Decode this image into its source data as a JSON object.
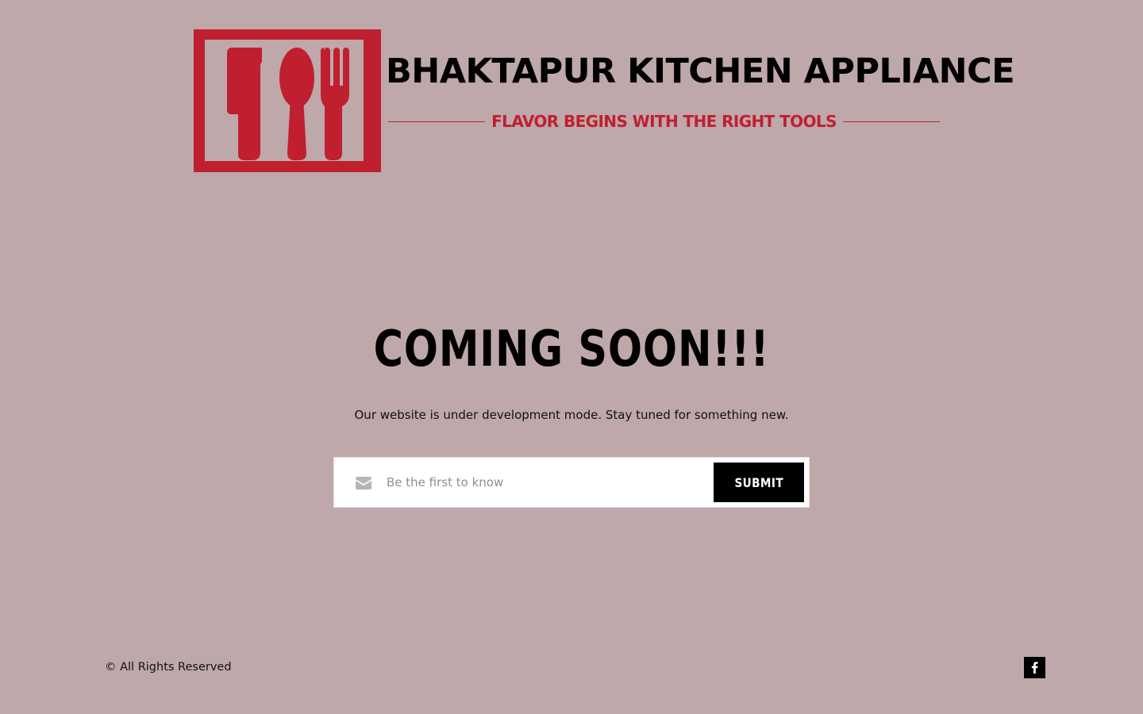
{
  "brand": {
    "name": "BHAKTAPUR KITCHEN APPLIANCE",
    "tagline": "FLAVOR BEGINS WITH THE RIGHT TOOLS",
    "logo_icon": "knife-spoon-fork-icon",
    "accent_color": "#c01f30"
  },
  "main": {
    "heading": "COMING SOON!!!",
    "description": "Our website is under development mode. Stay tuned for something new.",
    "form": {
      "email_placeholder": "Be the first to know",
      "email_value": "",
      "submit_label": "SUBMIT",
      "icon": "envelope-icon"
    }
  },
  "footer": {
    "copyright": "© All Rights Reserved",
    "social": [
      {
        "icon": "facebook-icon"
      }
    ]
  },
  "colors": {
    "background": "#bea8aa",
    "text": "#000000",
    "button": "#000000"
  }
}
